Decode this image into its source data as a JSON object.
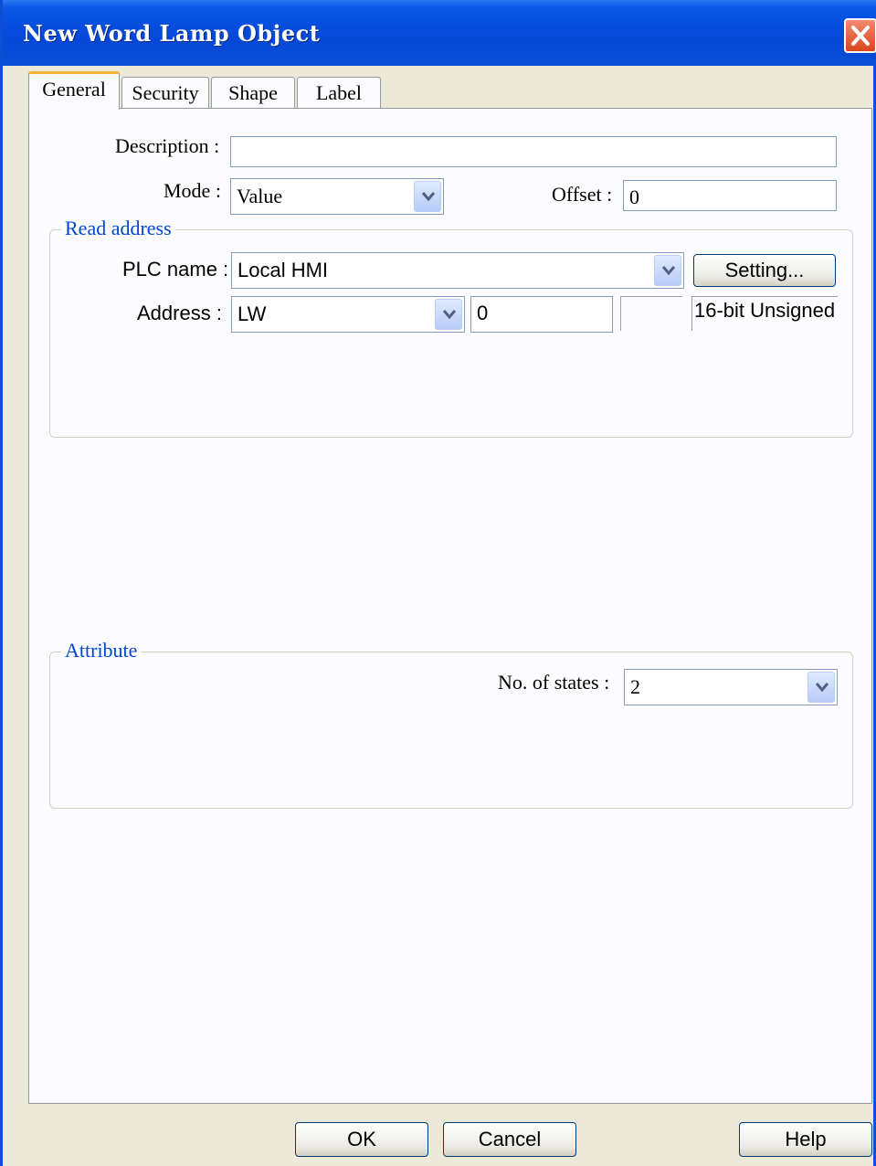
{
  "window": {
    "title": "New  Word Lamp Object"
  },
  "tabs": [
    {
      "label": "General"
    },
    {
      "label": "Security"
    },
    {
      "label": "Shape"
    },
    {
      "label": "Label"
    }
  ],
  "general": {
    "description_label": "Description :",
    "description_value": "",
    "mode_label": "Mode :",
    "mode_value": "Value",
    "offset_label": "Offset :",
    "offset_value": "0"
  },
  "read_address": {
    "title": "Read address",
    "plc_label": "PLC name :",
    "plc_value": "Local HMI",
    "setting_button": "Setting...",
    "address_label": "Address :",
    "address_device": "LW",
    "address_value": "0",
    "address_suffix": "",
    "data_format": "16-bit Unsigned"
  },
  "attribute": {
    "title": "Attribute",
    "states_label": "No. of states :",
    "states_value": "2"
  },
  "buttons": {
    "ok": "OK",
    "cancel": "Cancel",
    "help": "Help"
  },
  "colors": {
    "titlebar": "#0a4fd4",
    "dialog_bg": "#ece9d8",
    "group_title": "#0046d5",
    "active_tab_accent": "#f5b33a"
  }
}
